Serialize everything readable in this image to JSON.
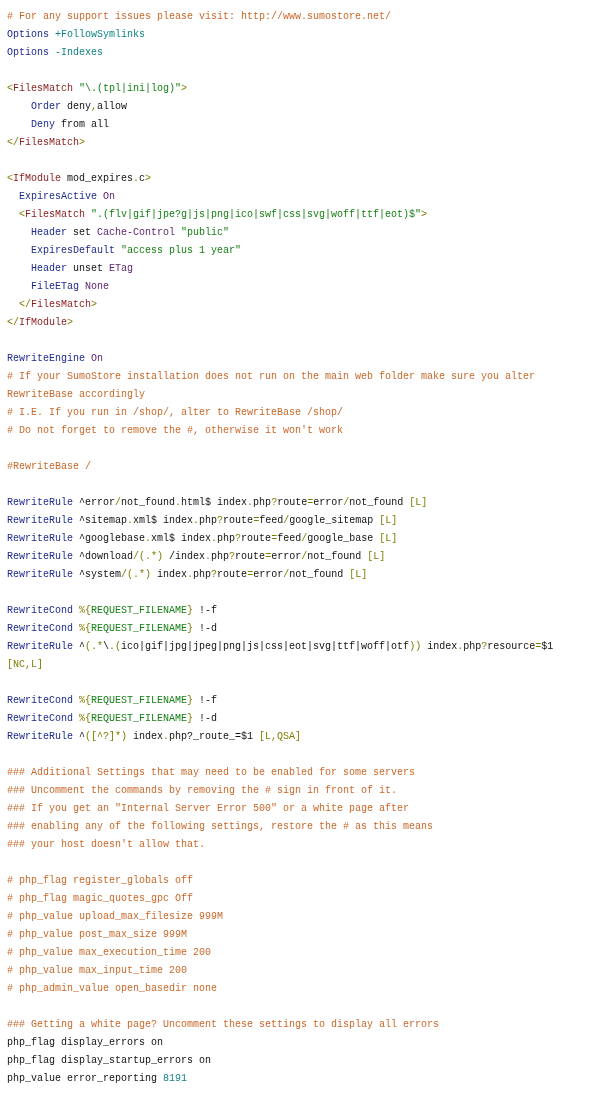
{
  "code_listing": {
    "blocks": [
      {
        "lines": [
          {
            "segments": [
              {
                "kind": "comment",
                "text": "# For any support issues please visit: http://www.sumostore.net/"
              }
            ]
          },
          {
            "segments": [
              {
                "kind": "directive",
                "text": "Options"
              },
              {
                "kind": "option",
                "text": " +FollowSymlinks"
              }
            ]
          },
          {
            "segments": [
              {
                "kind": "directive",
                "text": "Options"
              },
              {
                "kind": "option",
                "text": " -Indexes"
              }
            ]
          }
        ]
      },
      {
        "lines": [
          {
            "segments": [
              {
                "kind": "punct",
                "text": "<"
              },
              {
                "kind": "tag",
                "text": "FilesMatch"
              },
              {
                "kind": "string",
                "text": " \"\\.(tpl|ini|log)\""
              },
              {
                "kind": "punct",
                "text": ">"
              }
            ]
          },
          {
            "segments": [
              {
                "kind": "directive",
                "text": "    Order"
              },
              {
                "kind": "plain",
                "text": " deny"
              },
              {
                "kind": "punct",
                "text": ","
              },
              {
                "kind": "plain",
                "text": "allow"
              }
            ]
          },
          {
            "segments": [
              {
                "kind": "directive",
                "text": "    Deny"
              },
              {
                "kind": "plain",
                "text": " from all"
              }
            ]
          },
          {
            "segments": [
              {
                "kind": "punct",
                "text": "</"
              },
              {
                "kind": "tag",
                "text": "FilesMatch"
              },
              {
                "kind": "punct",
                "text": ">"
              }
            ]
          }
        ]
      },
      {
        "lines": [
          {
            "segments": [
              {
                "kind": "punct",
                "text": "<"
              },
              {
                "kind": "tag",
                "text": "IfModule"
              },
              {
                "kind": "plain",
                "text": " mod_expires"
              },
              {
                "kind": "punct",
                "text": "."
              },
              {
                "kind": "plain",
                "text": "c"
              },
              {
                "kind": "punct",
                "text": ">"
              }
            ]
          },
          {
            "segments": [
              {
                "kind": "directive",
                "text": "  ExpiresActive"
              },
              {
                "kind": "value",
                "text": " On"
              }
            ]
          },
          {
            "segments": [
              {
                "kind": "punct",
                "text": "  <"
              },
              {
                "kind": "tag",
                "text": "FilesMatch"
              },
              {
                "kind": "string",
                "text": " \".(flv|gif|jpe?g|js|png|ico|swf|css|svg|woff|ttf|eot)$\""
              },
              {
                "kind": "punct",
                "text": ">"
              }
            ]
          },
          {
            "segments": [
              {
                "kind": "directive",
                "text": "    Header"
              },
              {
                "kind": "plain",
                "text": " set"
              },
              {
                "kind": "value",
                "text": " Cache-Control"
              },
              {
                "kind": "string",
                "text": " \"public\""
              }
            ]
          },
          {
            "segments": [
              {
                "kind": "directive",
                "text": "    ExpiresDefault"
              },
              {
                "kind": "string",
                "text": " \"access plus 1 year\""
              }
            ]
          },
          {
            "segments": [
              {
                "kind": "directive",
                "text": "    Header"
              },
              {
                "kind": "plain",
                "text": " unset"
              },
              {
                "kind": "value",
                "text": " ETag"
              }
            ]
          },
          {
            "segments": [
              {
                "kind": "directive",
                "text": "    FileETag"
              },
              {
                "kind": "value",
                "text": " None"
              }
            ]
          },
          {
            "segments": [
              {
                "kind": "punct",
                "text": "  </"
              },
              {
                "kind": "tag",
                "text": "FilesMatch"
              },
              {
                "kind": "punct",
                "text": ">"
              }
            ]
          },
          {
            "segments": [
              {
                "kind": "punct",
                "text": "</"
              },
              {
                "kind": "tag",
                "text": "IfModule"
              },
              {
                "kind": "punct",
                "text": ">"
              }
            ]
          }
        ]
      },
      {
        "lines": [
          {
            "segments": [
              {
                "kind": "directive",
                "text": "RewriteEngine"
              },
              {
                "kind": "value",
                "text": " On"
              }
            ]
          },
          {
            "segments": [
              {
                "kind": "comment",
                "text": "# If your SumoStore installation does not run on the main web folder make sure you alter"
              }
            ]
          },
          {
            "segments": [
              {
                "kind": "comment",
                "text": "RewriteBase accordingly"
              }
            ]
          },
          {
            "segments": [
              {
                "kind": "comment",
                "text": "# I.E. If you run in /shop/, alter to RewriteBase /shop/"
              }
            ]
          },
          {
            "segments": [
              {
                "kind": "comment",
                "text": "# Do not forget to remove the #, otherwise it won't work"
              }
            ]
          }
        ]
      },
      {
        "lines": [
          {
            "segments": [
              {
                "kind": "comment",
                "text": "#RewriteBase /"
              }
            ]
          }
        ]
      },
      {
        "lines": [
          {
            "segments": [
              {
                "kind": "directive",
                "text": "RewriteRule"
              },
              {
                "kind": "plain",
                "text": " ^error"
              },
              {
                "kind": "punct",
                "text": "/"
              },
              {
                "kind": "plain",
                "text": "not_found"
              },
              {
                "kind": "punct",
                "text": "."
              },
              {
                "kind": "plain",
                "text": "html$ index"
              },
              {
                "kind": "punct",
                "text": "."
              },
              {
                "kind": "plain",
                "text": "php"
              },
              {
                "kind": "punct",
                "text": "?"
              },
              {
                "kind": "plain",
                "text": "route"
              },
              {
                "kind": "punct",
                "text": "="
              },
              {
                "kind": "plain",
                "text": "error"
              },
              {
                "kind": "punct",
                "text": "/"
              },
              {
                "kind": "plain",
                "text": "not_found "
              },
              {
                "kind": "punct",
                "text": "[L]"
              }
            ]
          },
          {
            "segments": [
              {
                "kind": "directive",
                "text": "RewriteRule"
              },
              {
                "kind": "plain",
                "text": " ^sitemap"
              },
              {
                "kind": "punct",
                "text": "."
              },
              {
                "kind": "plain",
                "text": "xml$ index"
              },
              {
                "kind": "punct",
                "text": "."
              },
              {
                "kind": "plain",
                "text": "php"
              },
              {
                "kind": "punct",
                "text": "?"
              },
              {
                "kind": "plain",
                "text": "route"
              },
              {
                "kind": "punct",
                "text": "="
              },
              {
                "kind": "plain",
                "text": "feed"
              },
              {
                "kind": "punct",
                "text": "/"
              },
              {
                "kind": "plain",
                "text": "google_sitemap "
              },
              {
                "kind": "punct",
                "text": "[L]"
              }
            ]
          },
          {
            "segments": [
              {
                "kind": "directive",
                "text": "RewriteRule"
              },
              {
                "kind": "plain",
                "text": " ^googlebase"
              },
              {
                "kind": "punct",
                "text": "."
              },
              {
                "kind": "plain",
                "text": "xml$ index"
              },
              {
                "kind": "punct",
                "text": "."
              },
              {
                "kind": "plain",
                "text": "php"
              },
              {
                "kind": "punct",
                "text": "?"
              },
              {
                "kind": "plain",
                "text": "route"
              },
              {
                "kind": "punct",
                "text": "="
              },
              {
                "kind": "plain",
                "text": "feed"
              },
              {
                "kind": "punct",
                "text": "/"
              },
              {
                "kind": "plain",
                "text": "google_base "
              },
              {
                "kind": "punct",
                "text": "[L]"
              }
            ]
          },
          {
            "segments": [
              {
                "kind": "directive",
                "text": "RewriteRule"
              },
              {
                "kind": "plain",
                "text": " ^download"
              },
              {
                "kind": "punct",
                "text": "/(.*)"
              },
              {
                "kind": "plain",
                "text": " /index"
              },
              {
                "kind": "punct",
                "text": "."
              },
              {
                "kind": "plain",
                "text": "php"
              },
              {
                "kind": "punct",
                "text": "?"
              },
              {
                "kind": "plain",
                "text": "route"
              },
              {
                "kind": "punct",
                "text": "="
              },
              {
                "kind": "plain",
                "text": "error"
              },
              {
                "kind": "punct",
                "text": "/"
              },
              {
                "kind": "plain",
                "text": "not_found "
              },
              {
                "kind": "punct",
                "text": "[L]"
              }
            ]
          },
          {
            "segments": [
              {
                "kind": "directive",
                "text": "RewriteRule"
              },
              {
                "kind": "plain",
                "text": " ^system"
              },
              {
                "kind": "punct",
                "text": "/(.*)"
              },
              {
                "kind": "plain",
                "text": " index"
              },
              {
                "kind": "punct",
                "text": "."
              },
              {
                "kind": "plain",
                "text": "php"
              },
              {
                "kind": "punct",
                "text": "?"
              },
              {
                "kind": "plain",
                "text": "route"
              },
              {
                "kind": "punct",
                "text": "="
              },
              {
                "kind": "plain",
                "text": "error"
              },
              {
                "kind": "punct",
                "text": "/"
              },
              {
                "kind": "plain",
                "text": "not_found "
              },
              {
                "kind": "punct",
                "text": "[L]"
              }
            ]
          }
        ]
      },
      {
        "lines": [
          {
            "segments": [
              {
                "kind": "directive",
                "text": "RewriteCond"
              },
              {
                "kind": "punct",
                "text": " %{"
              },
              {
                "kind": "string",
                "text": "REQUEST_FILENAME"
              },
              {
                "kind": "punct",
                "text": "}"
              },
              {
                "kind": "plain",
                "text": " !-f"
              }
            ]
          },
          {
            "segments": [
              {
                "kind": "directive",
                "text": "RewriteCond"
              },
              {
                "kind": "punct",
                "text": " %{"
              },
              {
                "kind": "string",
                "text": "REQUEST_FILENAME"
              },
              {
                "kind": "punct",
                "text": "}"
              },
              {
                "kind": "plain",
                "text": " !-d"
              }
            ]
          },
          {
            "segments": [
              {
                "kind": "directive",
                "text": "RewriteRule"
              },
              {
                "kind": "plain",
                "text": " ^"
              },
              {
                "kind": "punct",
                "text": "(.*"
              },
              {
                "kind": "plain",
                "text": "\\"
              },
              {
                "kind": "punct",
                "text": ".("
              },
              {
                "kind": "plain",
                "text": "ico|gif|jpg|jpeg|png|js|css|eot|svg|ttf|woff|otf"
              },
              {
                "kind": "punct",
                "text": "))"
              },
              {
                "kind": "plain",
                "text": " index"
              },
              {
                "kind": "punct",
                "text": "."
              },
              {
                "kind": "plain",
                "text": "php"
              },
              {
                "kind": "punct",
                "text": "?"
              },
              {
                "kind": "plain",
                "text": "resource"
              },
              {
                "kind": "punct",
                "text": "="
              },
              {
                "kind": "plain",
                "text": "$1"
              }
            ]
          },
          {
            "segments": [
              {
                "kind": "punct",
                "text": "[NC,L]"
              }
            ]
          }
        ]
      },
      {
        "lines": [
          {
            "segments": [
              {
                "kind": "directive",
                "text": "RewriteCond"
              },
              {
                "kind": "punct",
                "text": " %{"
              },
              {
                "kind": "string",
                "text": "REQUEST_FILENAME"
              },
              {
                "kind": "punct",
                "text": "}"
              },
              {
                "kind": "plain",
                "text": " !-f"
              }
            ]
          },
          {
            "segments": [
              {
                "kind": "directive",
                "text": "RewriteCond"
              },
              {
                "kind": "punct",
                "text": " %{"
              },
              {
                "kind": "string",
                "text": "REQUEST_FILENAME"
              },
              {
                "kind": "punct",
                "text": "}"
              },
              {
                "kind": "plain",
                "text": " !-d"
              }
            ]
          },
          {
            "segments": [
              {
                "kind": "directive",
                "text": "RewriteRule"
              },
              {
                "kind": "plain",
                "text": " ^"
              },
              {
                "kind": "punct",
                "text": "([^?]*)"
              },
              {
                "kind": "plain",
                "text": " index"
              },
              {
                "kind": "punct",
                "text": "."
              },
              {
                "kind": "plain",
                "text": "php?_route_=$1 "
              },
              {
                "kind": "punct",
                "text": "[L,QSA]"
              }
            ]
          }
        ]
      },
      {
        "lines": [
          {
            "segments": [
              {
                "kind": "comment",
                "text": "### Additional Settings that may need to be enabled for some servers"
              }
            ]
          },
          {
            "segments": [
              {
                "kind": "comment",
                "text": "### Uncomment the commands by removing the # sign in front of it."
              }
            ]
          },
          {
            "segments": [
              {
                "kind": "comment",
                "text": "### If you get an \"Internal Server Error 500\" or a white page after"
              }
            ]
          },
          {
            "segments": [
              {
                "kind": "comment",
                "text": "### enabling any of the following settings, restore the # as this means"
              }
            ]
          },
          {
            "segments": [
              {
                "kind": "comment",
                "text": "### your host doesn't allow that."
              }
            ]
          }
        ]
      },
      {
        "lines": [
          {
            "segments": [
              {
                "kind": "comment",
                "text": "# php_flag register_globals off"
              }
            ]
          },
          {
            "segments": [
              {
                "kind": "comment",
                "text": "# php_flag magic_quotes_gpc Off"
              }
            ]
          },
          {
            "segments": [
              {
                "kind": "comment",
                "text": "# php_value upload_max_filesize 999M"
              }
            ]
          },
          {
            "segments": [
              {
                "kind": "comment",
                "text": "# php_value post_max_size 999M"
              }
            ]
          },
          {
            "segments": [
              {
                "kind": "comment",
                "text": "# php_value max_execution_time 200"
              }
            ]
          },
          {
            "segments": [
              {
                "kind": "comment",
                "text": "# php_value max_input_time 200"
              }
            ]
          },
          {
            "segments": [
              {
                "kind": "comment",
                "text": "# php_admin_value open_basedir none"
              }
            ]
          }
        ]
      },
      {
        "lines": [
          {
            "segments": [
              {
                "kind": "comment",
                "text": "### Getting a white page? Uncomment these settings to display all errors"
              }
            ]
          },
          {
            "segments": [
              {
                "kind": "plain",
                "text": "php_flag display_errors on"
              }
            ]
          },
          {
            "segments": [
              {
                "kind": "plain",
                "text": "php_flag display_startup_errors on"
              }
            ]
          },
          {
            "segments": [
              {
                "kind": "plain",
                "text": "php_value error_reporting "
              },
              {
                "kind": "number",
                "text": "8191"
              }
            ]
          }
        ]
      }
    ]
  }
}
